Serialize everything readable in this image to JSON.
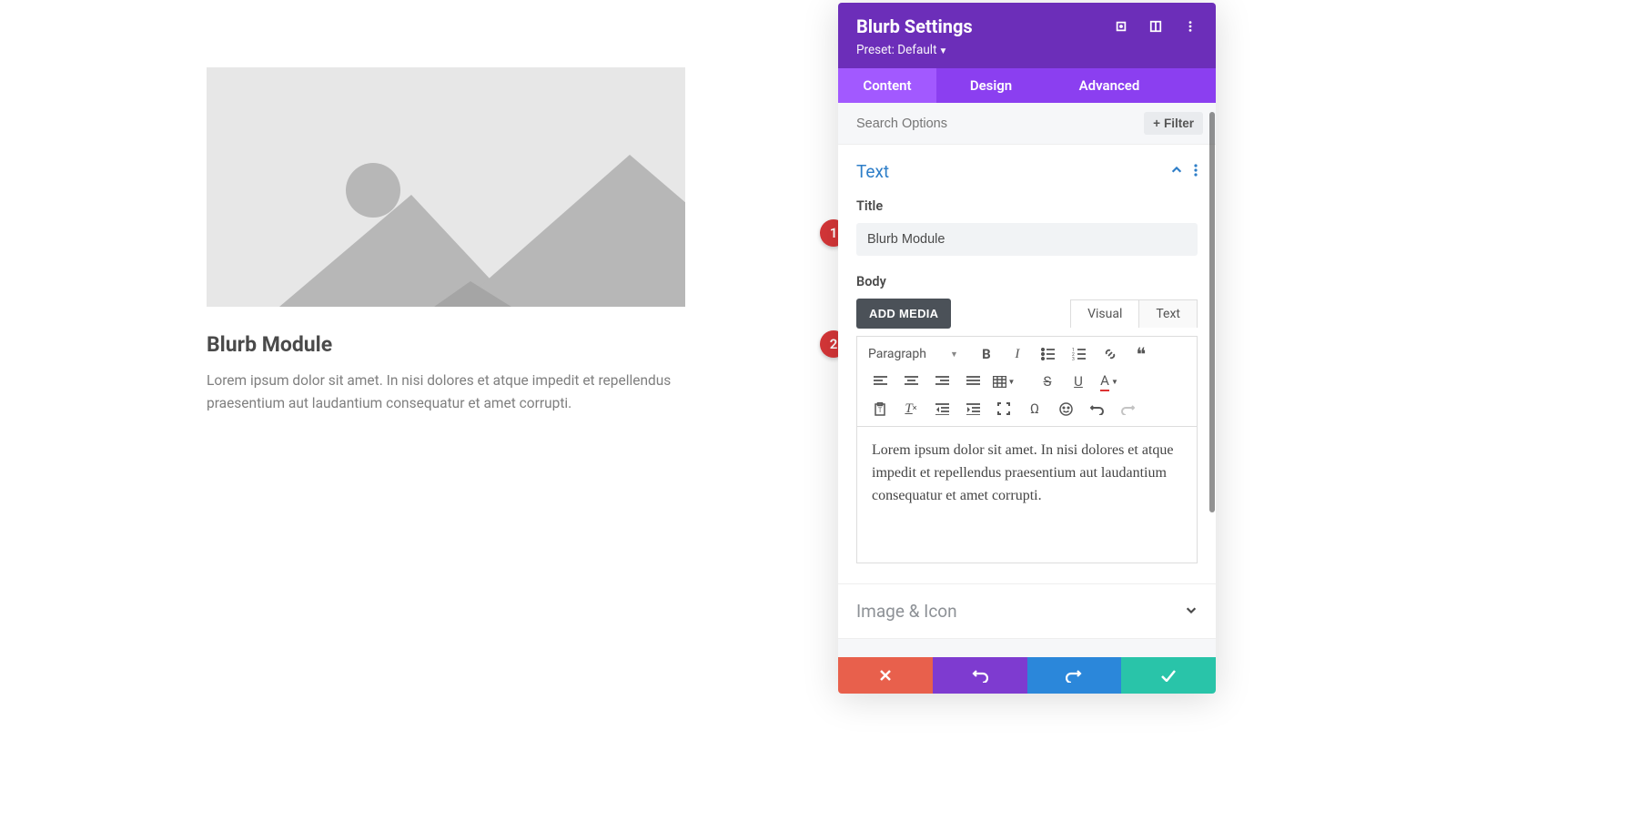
{
  "preview": {
    "title": "Blurb Module",
    "body": "Lorem ipsum dolor sit amet. In nisi dolores et atque impedit et repellendus praesentium aut laudantium consequatur et amet corrupti."
  },
  "panel": {
    "title": "Blurb Settings",
    "preset_label": "Preset: Default",
    "tabs": {
      "content": "Content",
      "design": "Design",
      "advanced": "Advanced"
    },
    "search_placeholder": "Search Options",
    "filter_label": "Filter"
  },
  "sections": {
    "text": {
      "title": "Text",
      "title_field_label": "Title",
      "title_value": "Blurb Module",
      "body_field_label": "Body",
      "add_media_label": "ADD MEDIA",
      "editor_tabs": {
        "visual": "Visual",
        "text": "Text"
      },
      "format_label": "Paragraph",
      "body_value": "Lorem ipsum dolor sit amet. In nisi dolores et atque impedit et repellendus praesentium aut laudantium consequatur et amet corrupti."
    },
    "image_icon": {
      "title": "Image & Icon"
    }
  },
  "badges": {
    "one": "1",
    "two": "2"
  }
}
